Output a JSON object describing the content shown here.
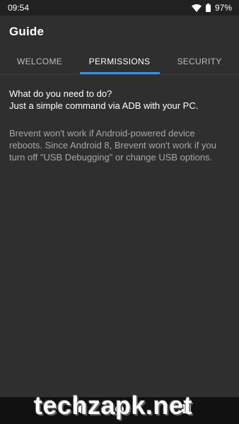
{
  "status_bar": {
    "time": "09:54",
    "battery": "97%",
    "icons": [
      "wifi-icon",
      "battery-icon"
    ]
  },
  "app_bar": {
    "title": "Guide"
  },
  "tabs": [
    {
      "label": "WELCOME",
      "active": false
    },
    {
      "label": "PERMISSIONS",
      "active": true
    },
    {
      "label": "SECURITY",
      "active": false
    }
  ],
  "content": {
    "intro_line_1": "What do you need to do?",
    "intro_line_2": "Just a simple command via ADB with your PC.",
    "warning": "Brevent won't work if Android-powered device reboots. Since Android 8, Brevent won't work if you turn off \"USB Debugging\" or change USB options."
  },
  "watermark": "techzapk.net",
  "nav_bar": {
    "buttons": [
      "back-icon",
      "home-icon",
      "recents-icon"
    ]
  },
  "colors": {
    "background": "#2f2f2f",
    "status_bar": "#212121",
    "accent": "#3f8fe0",
    "secondary_text": "#a6a6a6"
  }
}
